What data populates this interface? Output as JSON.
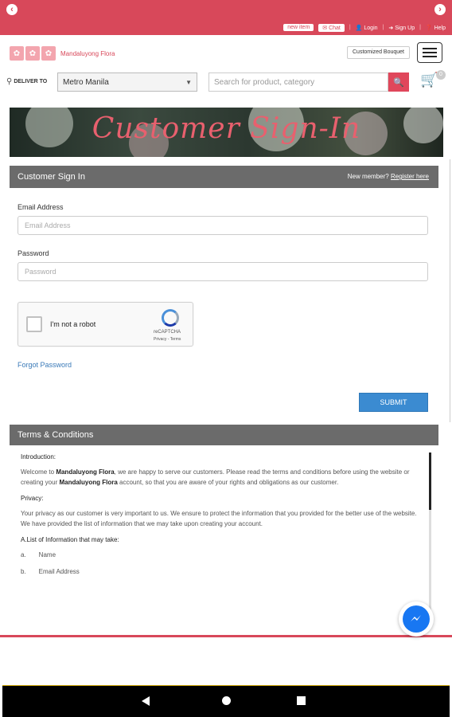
{
  "top_bar": {
    "new_item": "new item",
    "chat": "Chat",
    "login": "Login",
    "signup": "Sign Up",
    "help": "Help"
  },
  "header": {
    "logo_text": "Mandaluyong Flora",
    "customized_bouquet": "Customized Bouquet"
  },
  "delivery": {
    "label": "DELIVER TO",
    "selected": "Metro Manila"
  },
  "search": {
    "placeholder": "Search for product, category"
  },
  "cart": {
    "count": "0"
  },
  "banner": {
    "title": "Customer Sign-In"
  },
  "signin": {
    "title": "Customer Sign In",
    "new_member": "New member?",
    "register": "Register here",
    "email_label": "Email Address",
    "email_placeholder": "Email Address",
    "password_label": "Password",
    "password_placeholder": "Password",
    "recaptcha_label": "I'm not a robot",
    "recaptcha_brand": "reCAPTCHA",
    "recaptcha_terms": "Privacy - Terms",
    "forgot": "Forgot Password",
    "submit": "SUBMIT"
  },
  "terms": {
    "title": "Terms & Conditions",
    "intro_heading": "Introduction:",
    "intro_pre": "Welcome to ",
    "brand": "Mandaluyong Flora",
    "intro_mid": ", we are happy to serve our customers. Please read the terms and conditions before using the website or creating your ",
    "intro_post": " account, so that you are aware of your rights and obligations as our customer.",
    "privacy_heading": "Privacy:",
    "privacy_text": "Your privacy as our customer is very important to us. We ensure to protect the information that you provided for the better use of the website. We have provided the list of information that we may take upon creating your account.",
    "list_heading": "A.List of Information that may take:",
    "list": [
      {
        "marker": "a.",
        "text": "Name"
      },
      {
        "marker": "b.",
        "text": "Email Address"
      }
    ]
  },
  "colors": {
    "brand": "#d8485a",
    "panel_header": "#6b6b6b",
    "submit": "#3b8bd1",
    "link": "#3a7ab8"
  }
}
